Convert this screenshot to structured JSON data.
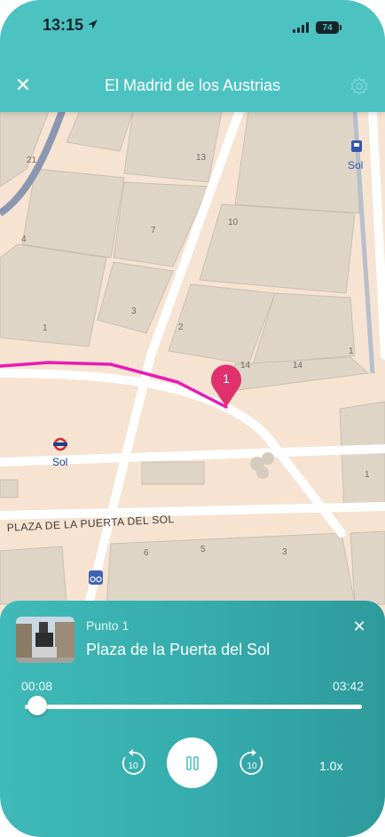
{
  "status_bar": {
    "time": "13:15",
    "battery": "74"
  },
  "header": {
    "title": "El Madrid de los Austrias"
  },
  "map": {
    "street_label": "PLAZA DE LA PUERTA DEL SOL",
    "metro_label_left": "Sol",
    "metro_label_right": "Sol",
    "marker_number": "1",
    "building_numbers": [
      "21",
      "13",
      "7",
      "4",
      "10",
      "3",
      "1",
      "2",
      "14",
      "14",
      "1",
      "1",
      "6",
      "5",
      "3"
    ],
    "colors": {
      "background": "#f6e3d2",
      "buildings": "#ded5c7",
      "route": "#e81ab6",
      "marker": "#e0316e"
    }
  },
  "player": {
    "point_label": "Punto 1",
    "place_name": "Plaza de la Puerta del Sol",
    "current_time": "00:08",
    "total_time": "03:42",
    "progress": 0.036,
    "rewind_label": "10",
    "forward_label": "10",
    "speed": "1.0x",
    "colors": {
      "accent": "#4cc3c1"
    }
  }
}
